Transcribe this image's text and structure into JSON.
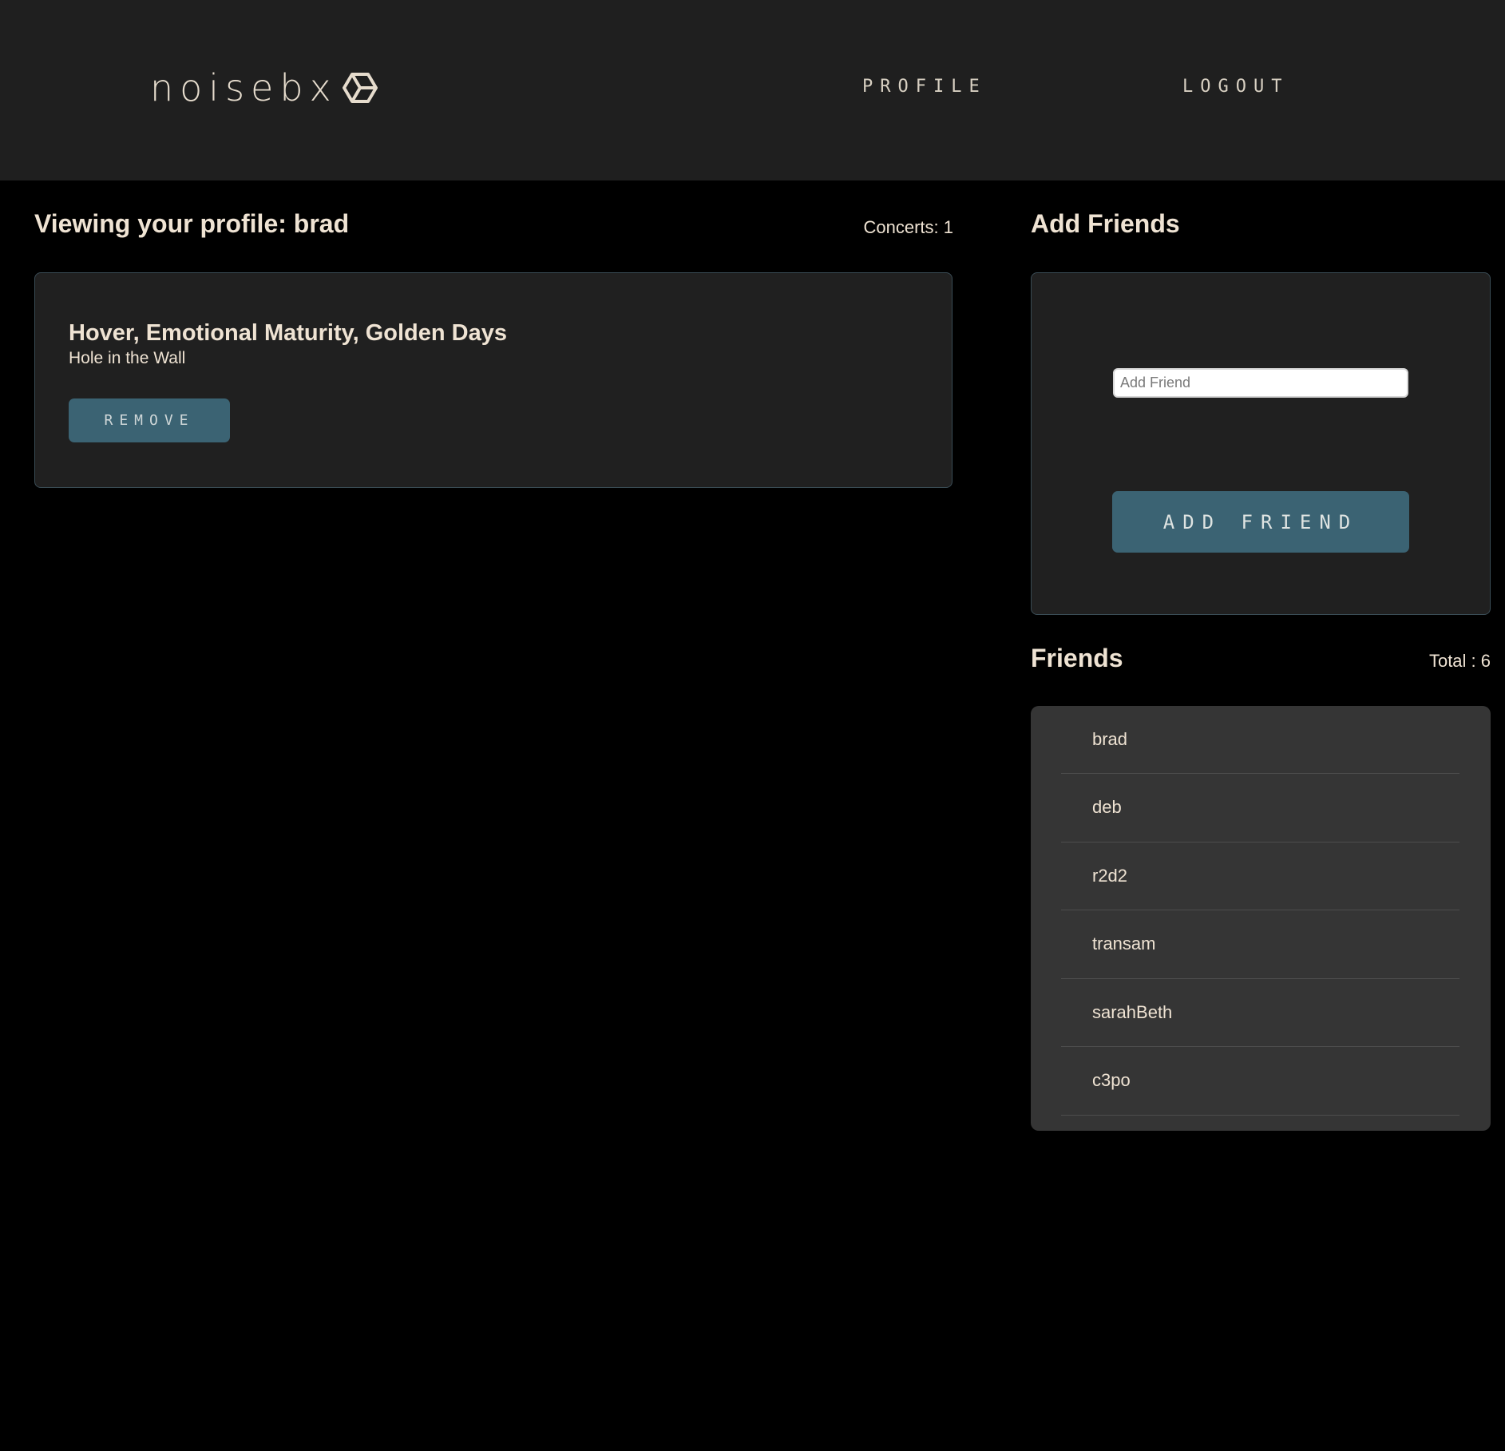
{
  "header": {
    "logo_text": "noisebx",
    "logo_icon": "hexagon-cube-icon",
    "nav": {
      "profile_label": "PROFILE",
      "logout_label": "LOGOUT"
    }
  },
  "profile": {
    "title": "Viewing your profile: brad",
    "concerts_count": "Concerts: 1",
    "concerts": [
      {
        "bands": "Hover, Emotional Maturity, Golden Days",
        "venue": "Hole in the Wall",
        "remove_label": "REMOVE"
      }
    ]
  },
  "add_friends": {
    "title": "Add Friends",
    "input_placeholder": "Add Friend",
    "input_value": "",
    "button_label": "ADD FRIEND"
  },
  "friends": {
    "title": "Friends",
    "total": "Total : 6",
    "items": [
      "brad",
      "deb",
      "r2d2",
      "transam",
      "sarahBeth",
      "c3po"
    ]
  },
  "colors": {
    "background": "#000000",
    "header_bg": "#1f1f1f",
    "card_bg": "#202020",
    "list_bg": "#353535",
    "accent": "#3b6373",
    "text": "#efe3d3"
  }
}
